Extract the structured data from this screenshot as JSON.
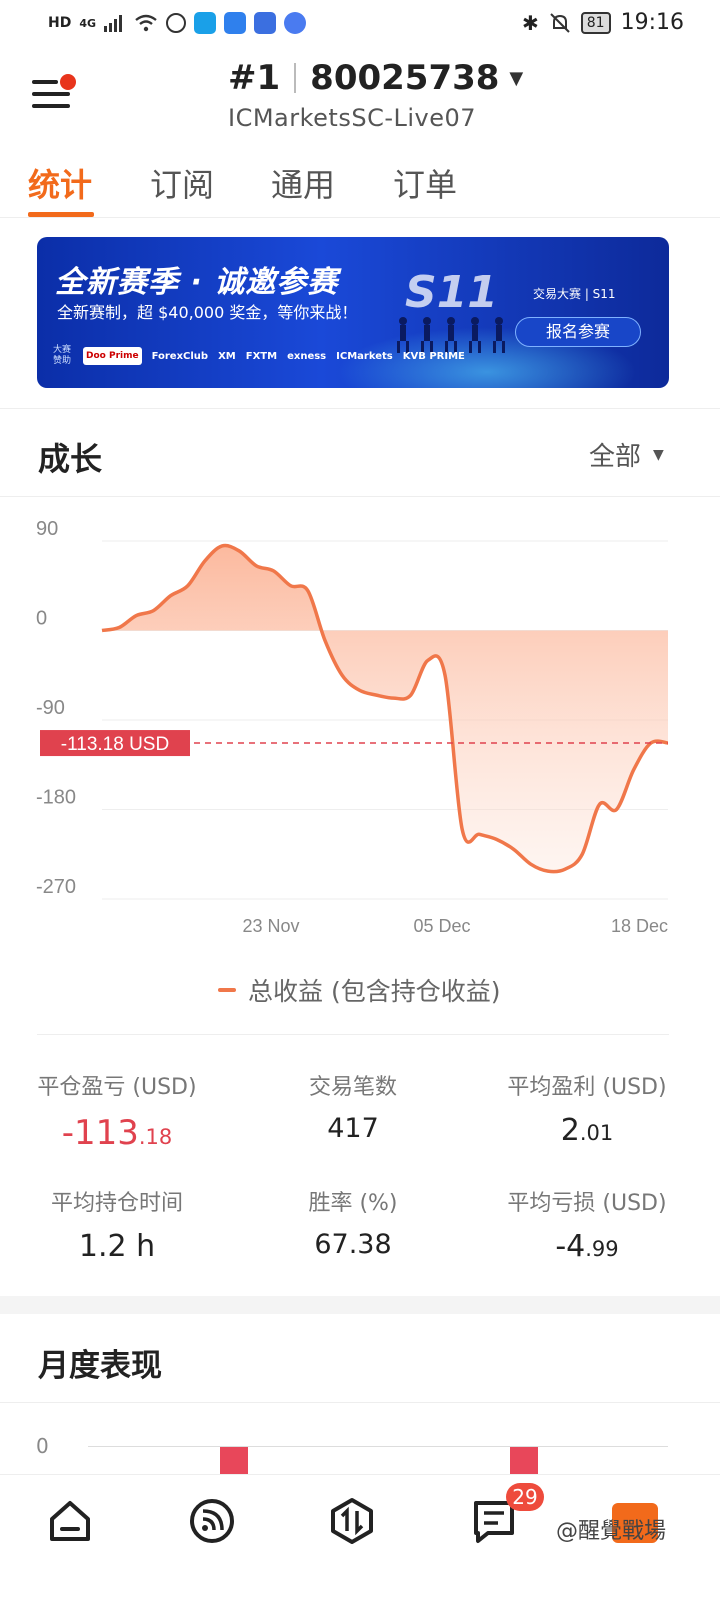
{
  "status_bar": {
    "network_label": "HD",
    "signal_label": "4G",
    "battery": "81",
    "time": "19:16"
  },
  "header": {
    "account_rank": "#1",
    "account_number": "80025738",
    "server": "ICMarketsSC-Live07"
  },
  "tabs": [
    {
      "label": "统计",
      "active": true
    },
    {
      "label": "订阅"
    },
    {
      "label": "通用"
    },
    {
      "label": "订单"
    }
  ],
  "banner": {
    "title": "全新赛季 · 诚邀参赛",
    "subtitle": "全新赛制，超 $40,000 奖金，等你来战！",
    "season": "S11",
    "brand": "交易大赛 | S11",
    "button_label": "报名参赛",
    "sponsor_label": "大赛赞助",
    "sponsors": [
      "Doo Prime",
      "ForexClub",
      "XM",
      "FXTM",
      "exness",
      "ICMarkets",
      "KVB PRIME"
    ]
  },
  "growth": {
    "title": "成长",
    "range_label": "全部"
  },
  "chart_data": {
    "type": "area",
    "y_ticks": [
      "90",
      "0",
      "-90",
      "-180",
      "-270"
    ],
    "ylim": [
      -270,
      90
    ],
    "x_ticks": [
      "23 Nov",
      "05 Dec",
      "18 Dec"
    ],
    "current_value_label": "-113.18 USD",
    "current_value": -113.18,
    "series": [
      {
        "name": "总收益 (包含持仓收益)",
        "color": "#f0774a",
        "values": [
          0,
          3,
          15,
          20,
          35,
          45,
          70,
          85,
          80,
          65,
          60,
          45,
          40,
          -10,
          -45,
          -60,
          -65,
          -68,
          -65,
          -30,
          -45,
          -200,
          -205,
          -210,
          -220,
          -235,
          -242,
          -240,
          -225,
          -175,
          -180,
          -140,
          -113.18,
          -113.18
        ]
      }
    ]
  },
  "stats": [
    {
      "label": "平仓盈亏 (USD)",
      "value_int": "-113",
      "value_dec": ".18",
      "negative": true
    },
    {
      "label": "交易笔数",
      "value_int": "417",
      "value_dec": ""
    },
    {
      "label": "平均盈利 (USD)",
      "value_int": "2",
      "value_dec": ".01"
    },
    {
      "label": "平均持仓时间",
      "value_int": "1.2 h",
      "value_dec": ""
    },
    {
      "label": "胜率 (%)",
      "value_int": "67.38",
      "value_dec": ""
    },
    {
      "label": "平均亏损 (USD)",
      "value_int": "-4",
      "value_dec": ".99"
    }
  ],
  "monthly": {
    "title": "月度表现",
    "zero_label": "0"
  },
  "bottom_nav": {
    "badge_count": "29",
    "watermark": "@醒覺戰場"
  }
}
